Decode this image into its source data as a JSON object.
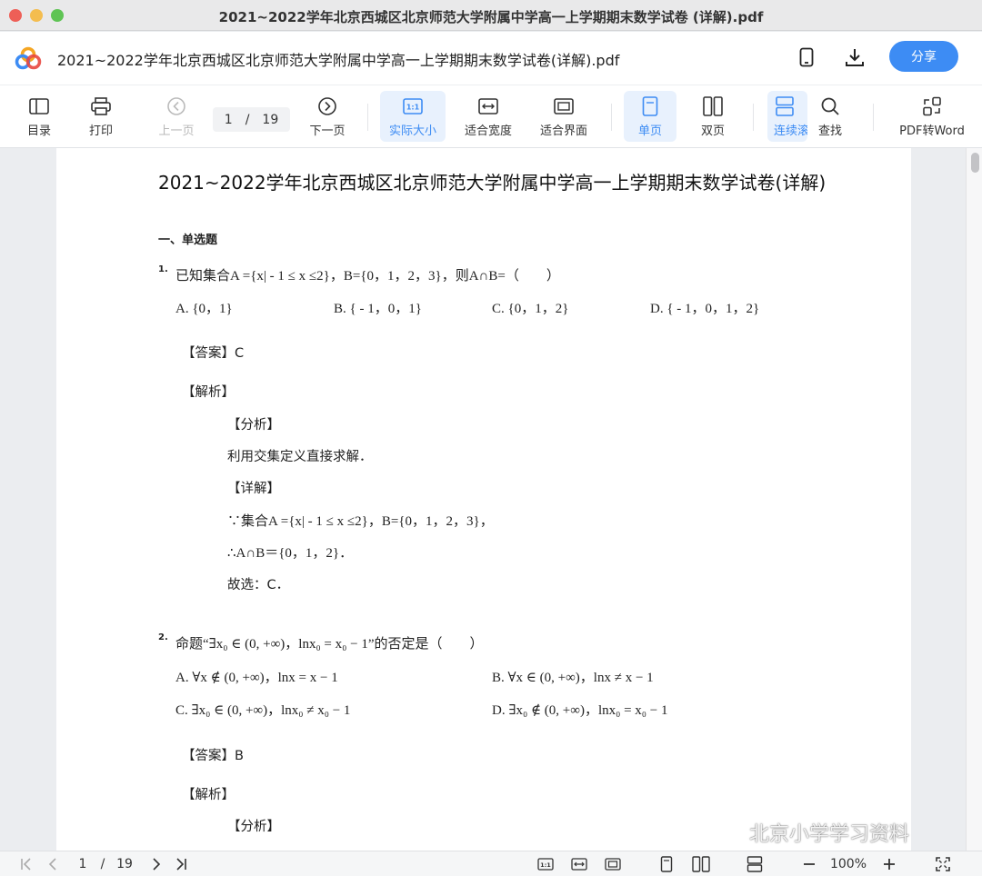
{
  "window": {
    "title": "2021~2022学年北京西城区北京师范大学附属中学高一上学期期末数学试卷 (详解).pdf"
  },
  "header": {
    "doc_title": "2021~2022学年北京西城区北京师范大学附属中学高一上学期期末数学试卷(详解).pdf",
    "share_label": "分享"
  },
  "toolbar": {
    "toc": "目录",
    "print": "打印",
    "prev": "上一页",
    "current_page": "1",
    "slash": "/",
    "total_pages": "19",
    "next": "下一页",
    "actual_size": "实际大小",
    "fit_width": "适合宽度",
    "fit_page": "适合界面",
    "single": "单页",
    "double": "双页",
    "continuous": "连续滚",
    "find": "查找",
    "pdf2word": "PDF转Word"
  },
  "document": {
    "title": "2021~2022学年北京西城区北京师范大学附属中学高一上学期期末数学试卷(详解)",
    "section": "一、单选题",
    "q1": {
      "num": "1.",
      "stem": "已知集合A ={x| - 1 ≤ x ≤2}，B={0，1，2，3}，则A∩B=（　　）",
      "a": "A. {0，1}",
      "b": "B. { - 1，0，1}",
      "c": "C. {0，1，2}",
      "d": "D. { - 1，0，1，2}",
      "answer": "【答案】C",
      "analysis": "【解析】",
      "fenxi": "【分析】",
      "fenxi_text": "利用交集定义直接求解．",
      "xiangjie": "【详解】",
      "line1": "∵集合A ={x| - 1 ≤ x ≤2}，B={0，1，2，3}，",
      "line2": "∴A∩B＝{0，1，2}．",
      "line3": "故选：C．"
    },
    "q2": {
      "num": "2.",
      "stem": "命题“∃x₀ ∈ (0, +∞)，lnx₀ = x₀ − 1”的否定是（　　）",
      "a": "A. ∀x ∉ (0, +∞)，lnx = x − 1",
      "b": "B. ∀x ∈ (0, +∞)，lnx ≠ x − 1",
      "c": "C. ∃x₀ ∈ (0, +∞)，lnx₀ ≠ x₀ − 1",
      "d": "D. ∃x₀ ∉ (0, +∞)，lnx₀ = x₀ − 1",
      "answer": "【答案】B",
      "analysis": "【解析】",
      "fenxi": "【分析】"
    }
  },
  "watermark": "北京小学学习资料",
  "bottombar": {
    "page": "1",
    "slash": "/",
    "total": "19",
    "zoom": "100%"
  },
  "colors": {
    "accent": "#3d8cf4",
    "active_bg": "#e8f1fd"
  }
}
